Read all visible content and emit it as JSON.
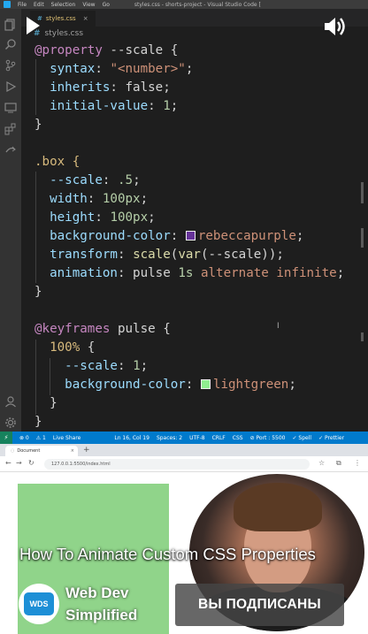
{
  "titlebar": {
    "menu": [
      "File",
      "Edit",
      "Selection",
      "View",
      "Go"
    ],
    "window_title": "styles.css - shorts-project - Visual Studio Code ["
  },
  "editor_tab": {
    "filename": "styles.css",
    "close_glyph": "×"
  },
  "breadcrumb": {
    "filename": "styles.css"
  },
  "code": {
    "l1": [
      "@property",
      " --scale {"
    ],
    "l2": [
      "  syntax",
      ": ",
      "\"<number>\"",
      ";"
    ],
    "l3": [
      "  inherits",
      ": false;"
    ],
    "l4": [
      "  initial-value",
      ": ",
      "1",
      ";"
    ],
    "l5": "}",
    "l7": ".box {",
    "l8": [
      "  --scale",
      ": ",
      ".5",
      ";"
    ],
    "l9": [
      "  width",
      ": ",
      "100px",
      ";"
    ],
    "l10": [
      "  height",
      ": ",
      "100px",
      ";"
    ],
    "l11": [
      "  background-color",
      ": ",
      "rebeccapurple",
      ";"
    ],
    "l12": [
      "  transform",
      ": ",
      "scale",
      "(",
      "var",
      "(--scale));"
    ],
    "l13": [
      "  animation",
      ": pulse ",
      "1s",
      " alternate infinite",
      ";"
    ],
    "l14": "}",
    "l16": [
      "@keyframes",
      " pulse {"
    ],
    "l17": [
      "  100%",
      " {"
    ],
    "l18": [
      "    --scale",
      ": ",
      "1",
      ";"
    ],
    "l19": [
      "    background-color",
      ": ",
      "lightgreen",
      ";"
    ],
    "l20": "  }",
    "l21": "}"
  },
  "colors": {
    "rebeccapurple": "#663399",
    "lightgreen": "#90ee90",
    "statusbar": "#007acc",
    "browser_green_box": "#90d48a"
  },
  "statusbar": {
    "errors": "⊗ 0",
    "warnings": "⚠ 1",
    "live_share": "Live Share",
    "position": "Ln 16, Col 19",
    "spaces": "Spaces: 2",
    "encoding": "UTF-8",
    "eol": "CRLF",
    "language": "CSS",
    "port": "⊘ Port : 5500",
    "spell": "✓ Spell",
    "prettier": "✓ Prettier"
  },
  "browser": {
    "tab_title": "Document",
    "url": "127.0.0.1:5500/index.html"
  },
  "video": {
    "title": "How To Animate Custom CSS Properties",
    "channel_name": "Web Dev Simplified",
    "channel_logo_text": "WDS",
    "subscribe_label": "ВЫ ПОДПИСАНЫ"
  }
}
